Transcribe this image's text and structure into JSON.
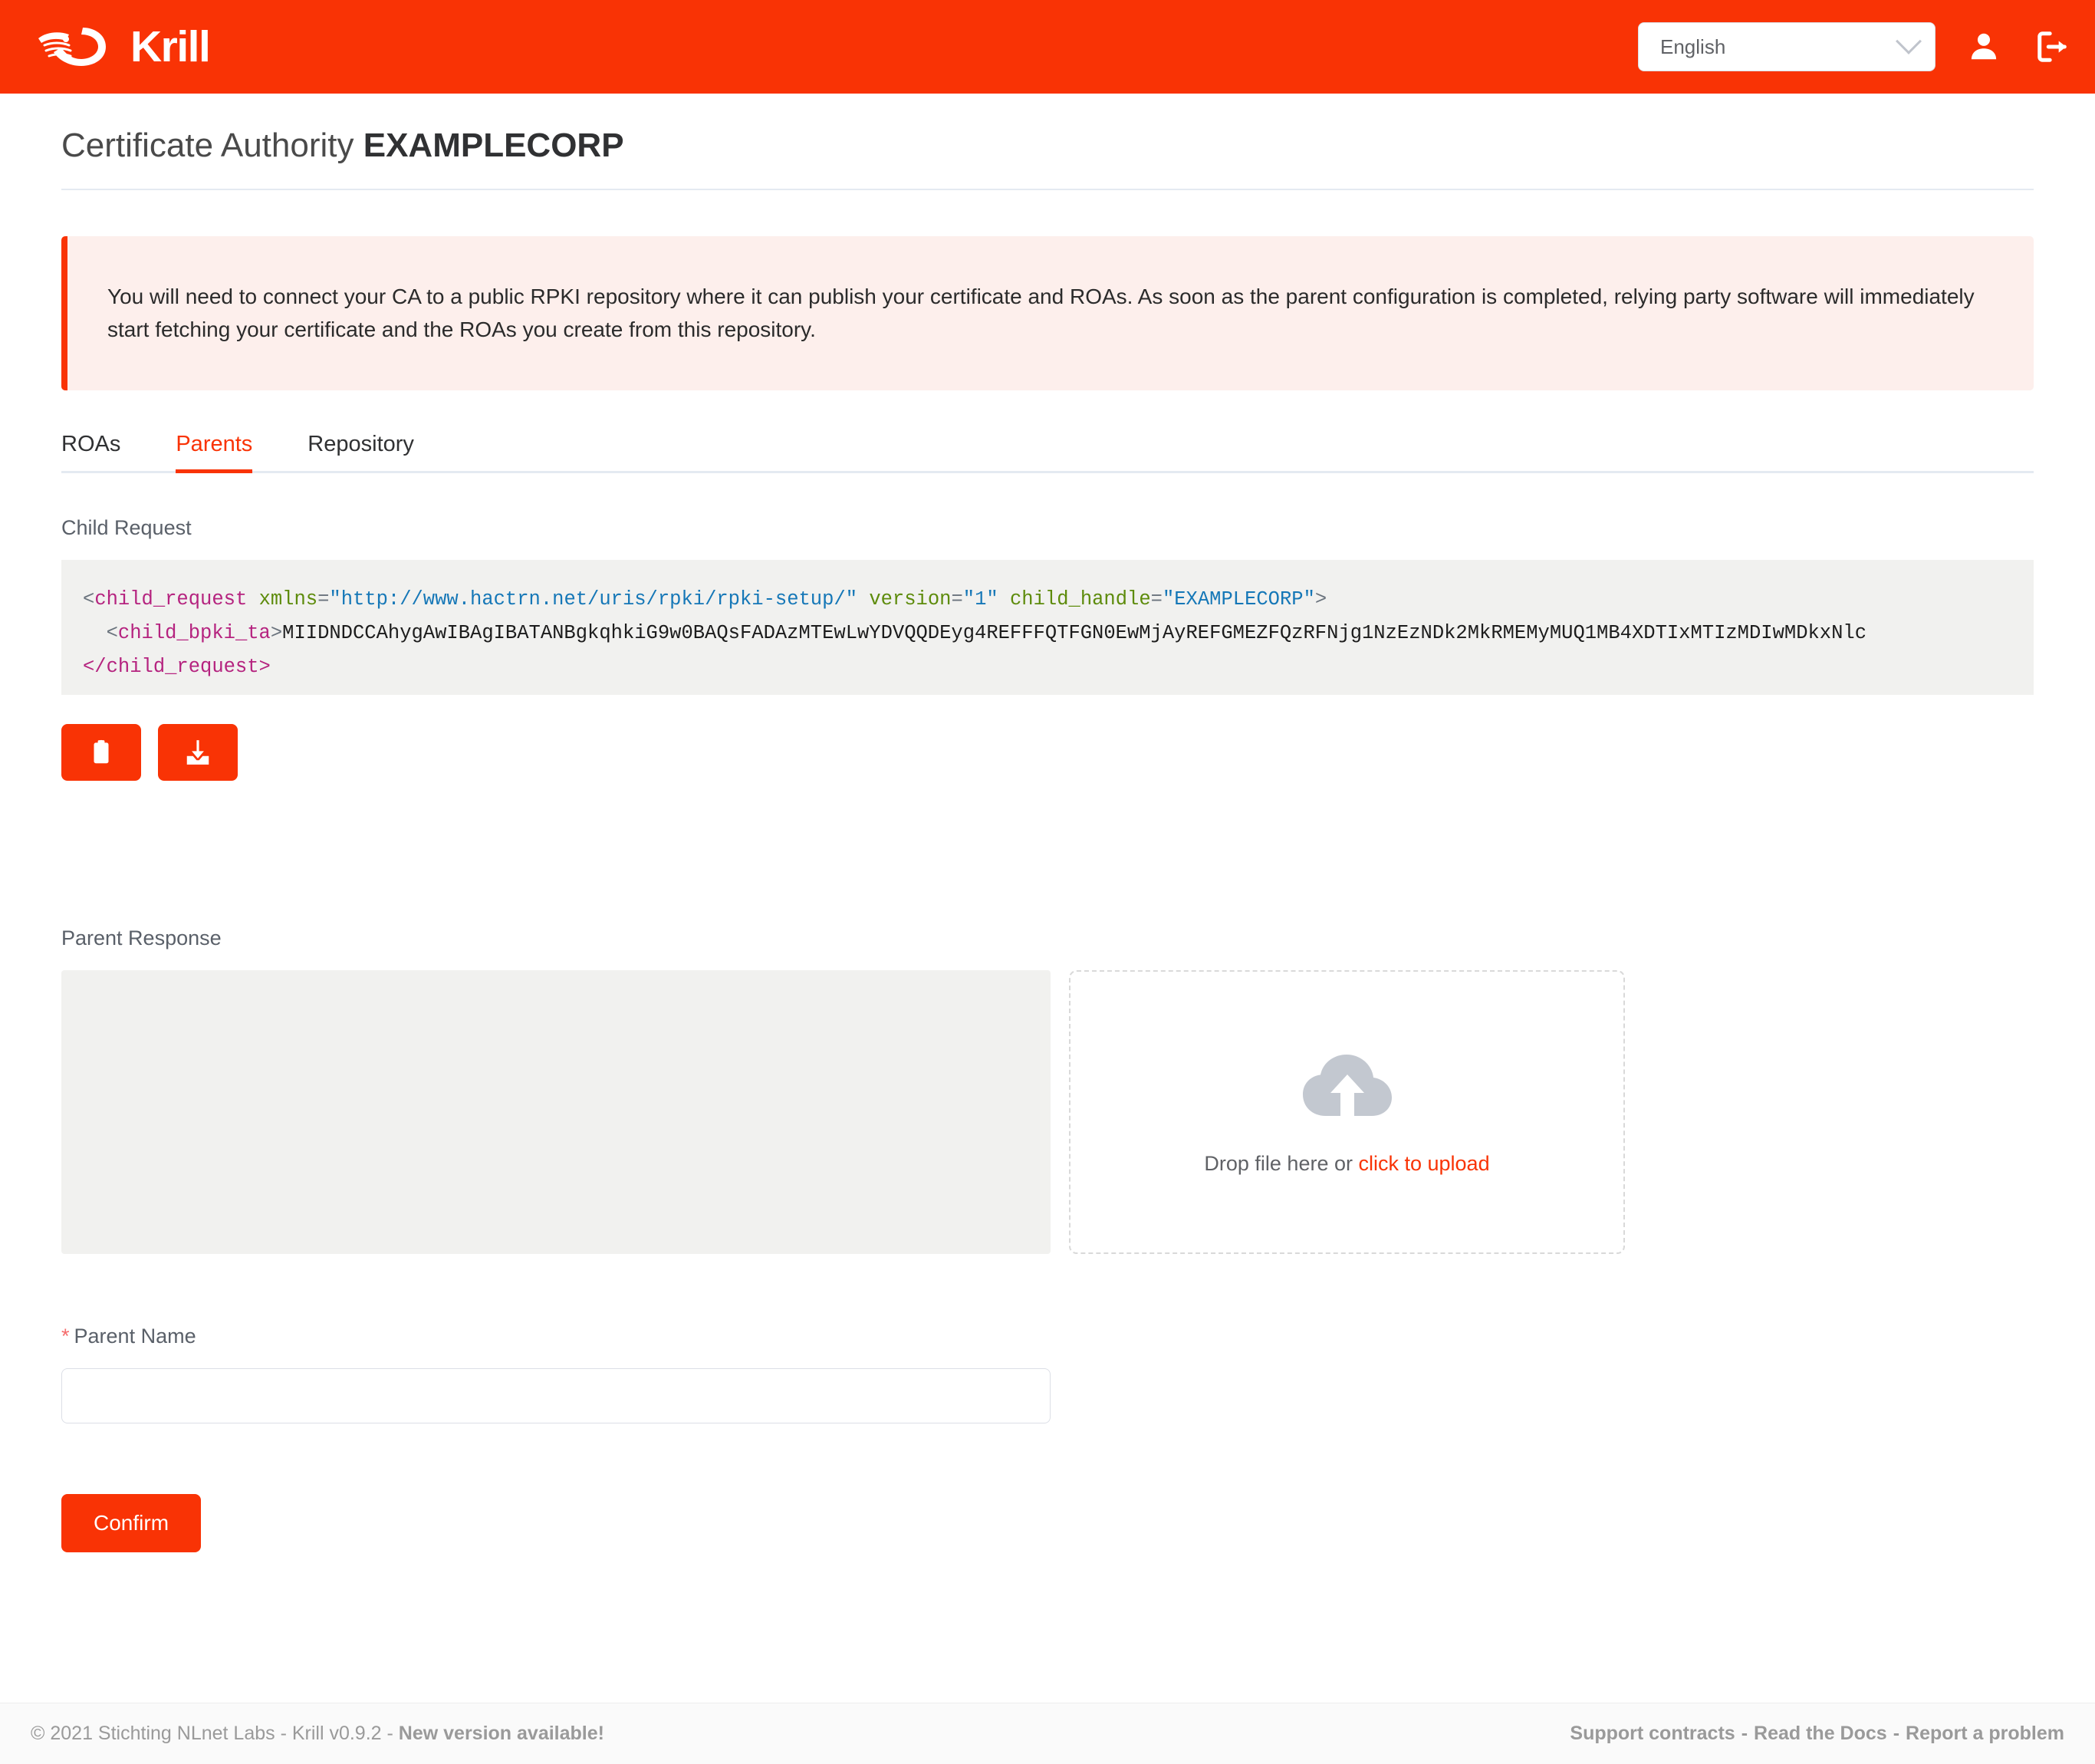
{
  "header": {
    "brand": "Krill",
    "brand_icon": "krill-shrimp-logo",
    "language": "English",
    "user_icon": "user-icon",
    "logout_icon": "logout-icon",
    "accent_color": "#F93305"
  },
  "page": {
    "title_prefix": "Certificate Authority",
    "ca_name": "EXAMPLECORP"
  },
  "alert": {
    "text": "You will need to connect your CA to a public RPKI repository where it can publish your certificate and ROAs. As soon as the parent configuration is completed, relying party software will immediately start fetching your certificate and the ROAs you create from this repository.",
    "border_color": "#F93305",
    "background_color": "#FDEFEC"
  },
  "tabs": [
    {
      "label": "ROAs",
      "active": false
    },
    {
      "label": "Parents",
      "active": true
    },
    {
      "label": "Repository",
      "active": false
    }
  ],
  "child_request": {
    "label": "Child Request",
    "xml": {
      "line1_open": "<",
      "line1_tag": "child_request",
      "line1_attr1": "xmlns",
      "line1_eq": "=",
      "line1_val1": "\"http://www.hactrn.net/uris/rpki/rpki-setup/\"",
      "line1_attr2": "version",
      "line1_val2": "\"1\"",
      "line1_attr3": "child_handle",
      "line1_val3": "\"EXAMPLECORP\"",
      "line1_close": ">",
      "line2_open": "<",
      "line2_tag": "child_bpki_ta",
      "line2_gt": ">",
      "line2_base64": "MIIDNDCCAhygAwIBAgIBATANBgkqhkiG9w0BAQsFADAzMTEwLwYDVQQDEyg4REFFFQTFGN0EwMjAyREFGMEZFQzRFNjg1NzEzNDk2MkRMEMyMUQ1MB4XDTIxMTIzMDIwMDkxNlc",
      "line3": "</child_request>"
    },
    "copy_button_icon": "clipboard-icon",
    "download_button_icon": "download-icon"
  },
  "parent_response": {
    "label": "Parent Response",
    "textarea_value": "",
    "textarea_placeholder": "",
    "dropzone": {
      "icon": "cloud-upload-icon",
      "text": "Drop file here or ",
      "link": "click to upload"
    }
  },
  "parent_name": {
    "required_marker": "*",
    "label": "Parent Name",
    "value": "",
    "placeholder": ""
  },
  "confirm": {
    "label": "Confirm"
  },
  "footer": {
    "copyright": "© 2021 Stichting NLnet Labs - Krill v0.9.2 - ",
    "new_version": "New version available!",
    "links": [
      {
        "label": "Support contracts"
      },
      {
        "label": "Read the Docs"
      },
      {
        "label": "Report a problem"
      }
    ],
    "separator": "-"
  }
}
